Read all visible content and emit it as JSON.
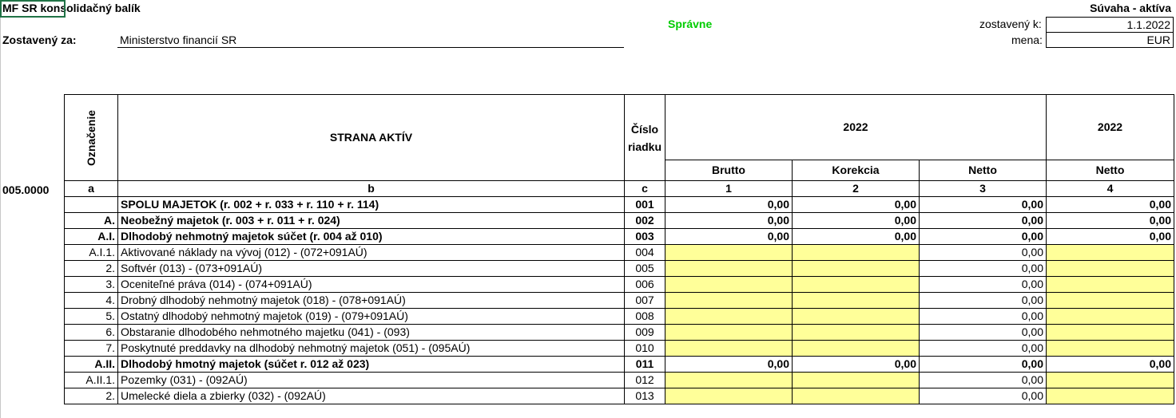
{
  "header": {
    "app_title": "MF SR konsolidačný balík",
    "status": "Správne",
    "sheet_title": "Súvaha - aktíva",
    "compiled_for_label": "Zostavený za:",
    "compiled_for_value": "Ministerstvo financií SR",
    "compiled_at_label": "zostavený k:",
    "compiled_at_value": "1.1.2022",
    "currency_label": "mena:",
    "currency_value": "EUR",
    "code": "005.0000"
  },
  "table": {
    "col_oznacenie": "Označenie",
    "col_strana": "STRANA AKTÍV",
    "col_cislo": "Číslo riadku",
    "year_a": "2022",
    "year_b": "2022",
    "col_brutto": "Brutto",
    "col_korekcia": "Korekcia",
    "col_netto": "Netto",
    "col_netto2": "Netto",
    "letters": [
      "a",
      "b",
      "c",
      "1",
      "2",
      "3",
      "4"
    ],
    "rows": [
      {
        "mark": "",
        "text": "SPOLU MAJETOK (r. 002 + r. 033 + r. 110 + r. 114)",
        "num": "001",
        "bold": true,
        "v1": "0,00",
        "v2": "0,00",
        "v3": "0,00",
        "v4": "0,00",
        "input": false
      },
      {
        "mark": "A.",
        "text": "Neobežný majetok (r. 003 + r. 011 + r. 024)",
        "num": "002",
        "bold": true,
        "v1": "0,00",
        "v2": "0,00",
        "v3": "0,00",
        "v4": "0,00",
        "input": false
      },
      {
        "mark": "A.I.",
        "text": "Dlhodobý nehmotný majetok   súčet (r. 004 až 010)",
        "num": "003",
        "bold": true,
        "v1": "0,00",
        "v2": "0,00",
        "v3": "0,00",
        "v4": "0,00",
        "input": false
      },
      {
        "mark": "A.I.1.",
        "text": "Aktivované náklady na vývoj  (012) - (072+091AÚ)",
        "num": "004",
        "bold": false,
        "v1": "",
        "v2": "",
        "v3": "0,00",
        "v4": "",
        "input": true
      },
      {
        "mark": "2.",
        "text": "Softvér (013) - (073+091AÚ)",
        "num": "005",
        "bold": false,
        "v1": "",
        "v2": "",
        "v3": "0,00",
        "v4": "",
        "input": true
      },
      {
        "mark": "3.",
        "text": "Oceniteľné práva (014) - (074+091AÚ)",
        "num": "006",
        "bold": false,
        "v1": "",
        "v2": "",
        "v3": "0,00",
        "v4": "",
        "input": true
      },
      {
        "mark": "4.",
        "text": "Drobný dlhodobý nehmotný majetok (018) - (078+091AÚ)",
        "num": "007",
        "bold": false,
        "v1": "",
        "v2": "",
        "v3": "0,00",
        "v4": "",
        "input": true
      },
      {
        "mark": "5.",
        "text": "Ostatný dlhodobý nehmotný majetok (019) - (079+091AÚ)",
        "num": "008",
        "bold": false,
        "v1": "",
        "v2": "",
        "v3": "0,00",
        "v4": "",
        "input": true
      },
      {
        "mark": "6.",
        "text": "Obstaranie dlhodobého nehmotného majetku (041) - (093)",
        "num": "009",
        "bold": false,
        "v1": "",
        "v2": "",
        "v3": "0,00",
        "v4": "",
        "input": true
      },
      {
        "mark": "7.",
        "text": "Poskytnuté preddavky na dlhodobý nehmotný majetok (051) - (095AÚ)",
        "num": "010",
        "bold": false,
        "v1": "",
        "v2": "",
        "v3": "0,00",
        "v4": "",
        "input": true
      },
      {
        "mark": "A.II.",
        "text": "Dlhodobý hmotný majetok   (súčet r. 012 až 023)",
        "num": "011",
        "bold": true,
        "v1": "0,00",
        "v2": "0,00",
        "v3": "0,00",
        "v4": "0,00",
        "input": false
      },
      {
        "mark": "A.II.1.",
        "text": "Pozemky (031) - (092AÚ)",
        "num": "012",
        "bold": false,
        "v1": "",
        "v2": "",
        "v3": "0,00",
        "v4": "",
        "input": true
      },
      {
        "mark": "2.",
        "text": "Umelecké diela a zbierky (032) - (092AÚ)",
        "num": "013",
        "bold": false,
        "v1": "",
        "v2": "",
        "v3": "0,00",
        "v4": "",
        "input": true
      }
    ]
  }
}
